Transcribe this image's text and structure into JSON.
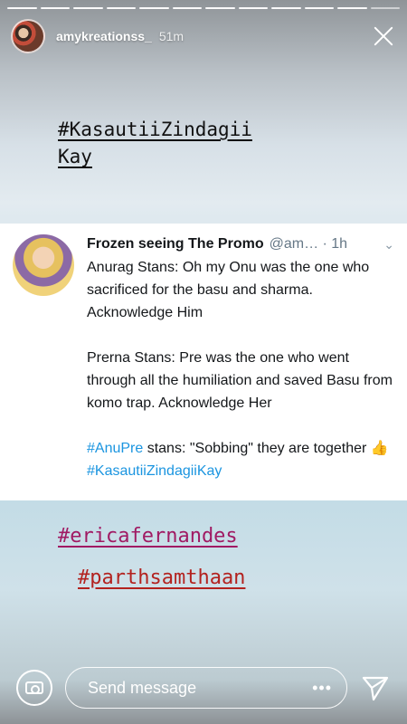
{
  "story": {
    "progress_segments": 12,
    "progress_done": 11,
    "username": "amykreationss_",
    "time": "51m",
    "top_tag_line1": "#KasautiiZindagii",
    "top_tag_line2": "Kay",
    "bottom_tags": [
      "#ericafernandes",
      "#parthsamthaan"
    ]
  },
  "tweet": {
    "name": "Frozen seeing The Promo",
    "handle": "@am… · 1h",
    "paragraph1": "Anurag Stans: Oh my Onu was the one who sacrificed for the basu and sharma. Acknowledge Him",
    "paragraph2": "Prerna Stans: Pre was the one who went through all the humiliation and saved Basu from komo trap. Acknowledge Her",
    "hashtag1": "#AnuPre",
    "paragraph3_rest": " stans: \"Sobbing\" they are together ",
    "thumb": "👍",
    "hashtag2": "#KasautiiZindagiiKay"
  },
  "footer": {
    "placeholder": "Send message",
    "more": "•••"
  },
  "icons": {
    "close": "close-icon",
    "camera": "camera-icon",
    "more": "more-icon",
    "direct": "direct-send-icon",
    "chevron": "chevron-down-icon"
  },
  "colors": {
    "hashtag_blue": "#1b95e0",
    "tag_erica": "#a01a63",
    "tag_parth": "#b3221f"
  }
}
